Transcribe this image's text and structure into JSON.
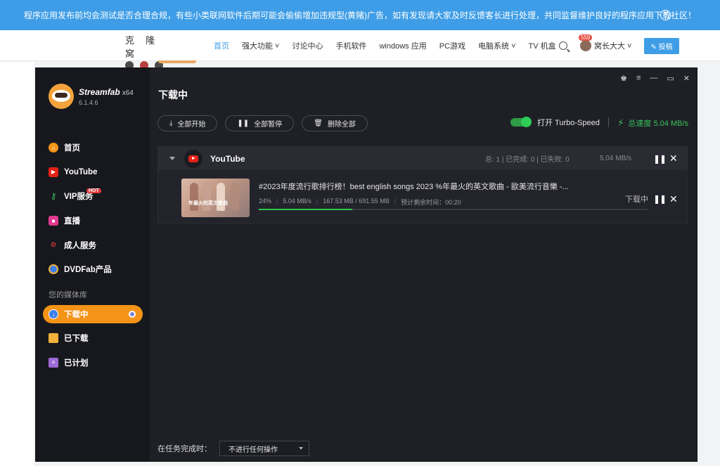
{
  "notice": {
    "text": "程序应用发布前均会测试是否合理合规，有些小类联网软件后期可能会偷偷增加违规型(黄赌)广告，如有发现请大家及时反馈客长进行处理，共同监督维护良好的程序应用下载社区！",
    "close_icon": "close-circle-icon"
  },
  "site": {
    "logo_text": "克 隆 窝",
    "nav": [
      "首页",
      "强大功能 ˅",
      "讨论中心",
      "手机软件",
      "windows 应用",
      "PC游戏",
      "电脑系统 ˅",
      "TV 机盒"
    ],
    "active_nav": "首页",
    "badge": "559",
    "user": "窝长大大 ˅",
    "submit": "投稿"
  },
  "app": {
    "brand": {
      "name": "Streamfab",
      "arch": "x64",
      "version": "6.1.4.6"
    },
    "menu": [
      {
        "label": "首页",
        "icon": "home-icon",
        "color": "#f39317"
      },
      {
        "label": "YouTube",
        "icon": "youtube-icon",
        "color": "#e62117"
      },
      {
        "label": "VIP服务",
        "icon": "key-icon",
        "color": "#36c25a",
        "badge": "HOT"
      },
      {
        "label": "直播",
        "icon": "live-camera-icon",
        "color": "#e0398f"
      },
      {
        "label": "成人服务",
        "icon": "adult-icon",
        "color": "#e23b3b"
      },
      {
        "label": "DVDFab产品",
        "icon": "dvdfab-icon",
        "color": "#3e7fe6"
      }
    ],
    "library_label": "您的媒体库",
    "library": [
      {
        "label": "下载中",
        "icon": "download-icon",
        "color": "#3e7fe6",
        "active": true
      },
      {
        "label": "已下载",
        "icon": "folder-icon",
        "color": "#f3b13b"
      },
      {
        "label": "已计划",
        "icon": "schedule-icon",
        "color": "#9d6ad6"
      }
    ],
    "page_title": "下载中",
    "toolbar": {
      "start_all": "全部开始",
      "pause_all": "全部暂停",
      "delete_all": "删除全部"
    },
    "turbo_label": "打开 Turbo-Speed",
    "total_speed": "总速度 5.04 MB/s",
    "group": {
      "name": "YouTube",
      "stats": "总: 1  |  已完成: 0  |  已失败: 0",
      "speed": "5.04 MB/s"
    },
    "task": {
      "title": "#2023年度流行歌排行榜！best english songs 2023 %年最火的英文歌曲 - 歐美流行音樂 -...",
      "thumb_text": "年最火的英文歌曲",
      "percent": "24%",
      "progress": 0.24,
      "speed": "5.04 MB/s",
      "size": "167.53 MB / 691.55 MB",
      "eta_label": "预计剩余时间：",
      "eta": "00:20",
      "status": "下载中"
    },
    "footer": {
      "label": "在任务完成时：",
      "select_value": "不进行任何操作"
    }
  }
}
